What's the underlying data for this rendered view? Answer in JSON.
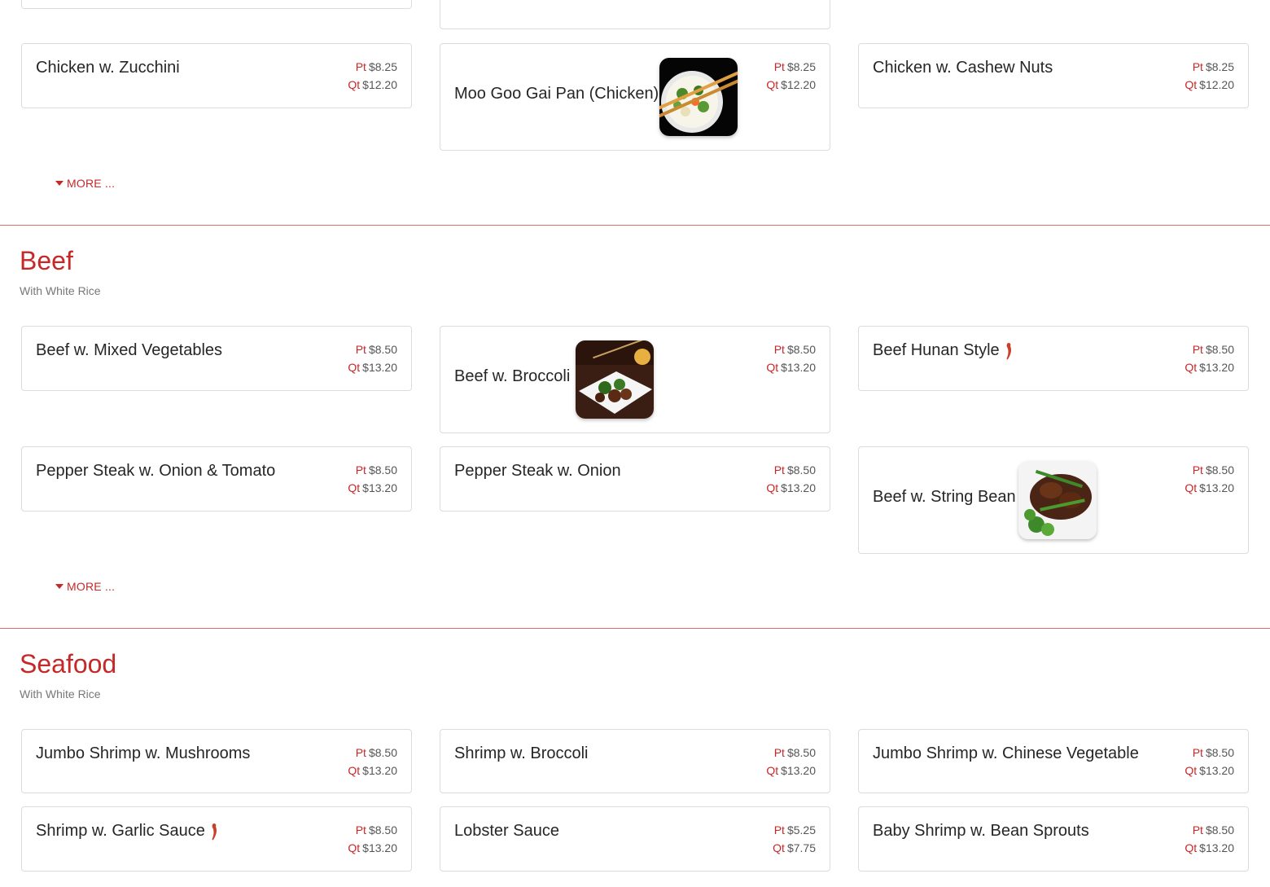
{
  "price_labels": {
    "pint": "Pt",
    "quart": "Qt"
  },
  "more_label": "MORE ...",
  "colors": {
    "accent": "#c62828",
    "border": "#dcdcdc"
  },
  "chicken": {
    "items": [
      {
        "name": "Chicken w. Zucchini",
        "pt": "$8.25",
        "qt": "$12.20"
      },
      {
        "name": "Moo Goo Gai Pan (Chicken)",
        "pt": "$8.25",
        "qt": "$12.20"
      },
      {
        "name": "Chicken w. Cashew Nuts",
        "pt": "$8.25",
        "qt": "$12.20"
      }
    ]
  },
  "beef": {
    "title": "Beef",
    "subtitle": "With White Rice",
    "items": [
      {
        "name": "Beef w. Mixed Vegetables",
        "pt": "$8.50",
        "qt": "$13.20"
      },
      {
        "name": "Beef w. Broccoli",
        "pt": "$8.50",
        "qt": "$13.20"
      },
      {
        "name": "Beef Hunan Style",
        "pt": "$8.50",
        "qt": "$13.20",
        "spicy": true
      },
      {
        "name": "Pepper Steak w. Onion & Tomato",
        "pt": "$8.50",
        "qt": "$13.20"
      },
      {
        "name": "Pepper Steak w. Onion",
        "pt": "$8.50",
        "qt": "$13.20"
      },
      {
        "name": "Beef w. String Bean",
        "pt": "$8.50",
        "qt": "$13.20"
      }
    ]
  },
  "seafood": {
    "title": "Seafood",
    "subtitle": "With White Rice",
    "items": [
      {
        "name": "Jumbo Shrimp w. Mushrooms",
        "pt": "$8.50",
        "qt": "$13.20"
      },
      {
        "name": "Shrimp w. Broccoli",
        "pt": "$8.50",
        "qt": "$13.20"
      },
      {
        "name": "Jumbo Shrimp w. Chinese Vegetable",
        "pt": "$8.50",
        "qt": "$13.20"
      },
      {
        "name": "Shrimp w. Garlic Sauce",
        "pt": "$8.50",
        "qt": "$13.20",
        "spicy": true
      },
      {
        "name": "Lobster Sauce",
        "pt": "$5.25",
        "qt": "$7.75"
      },
      {
        "name": "Baby Shrimp w. Bean Sprouts",
        "pt": "$8.50",
        "qt": "$13.20"
      }
    ]
  }
}
